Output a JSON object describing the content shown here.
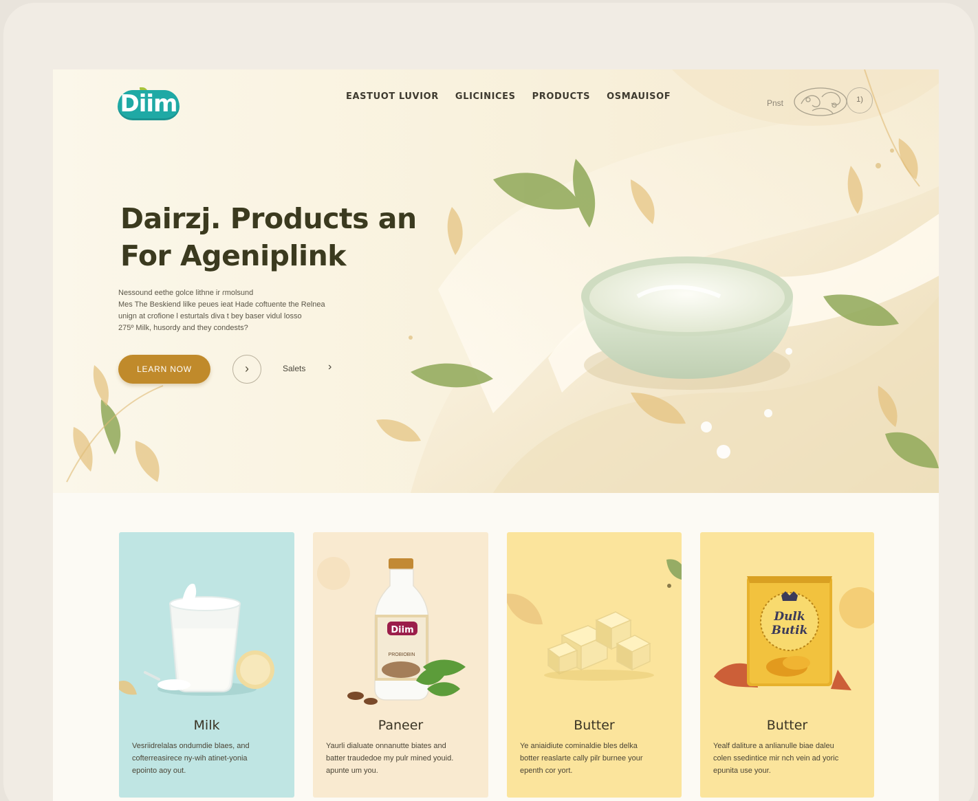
{
  "brand": {
    "logo_text": "Diim"
  },
  "nav": {
    "items": [
      {
        "label": "EASTUOT LUVIOR"
      },
      {
        "label": "GLICINICES"
      },
      {
        "label": "PRODUCTS"
      },
      {
        "label": "OSMAUISOF"
      }
    ],
    "print_label": "Pnst",
    "circle_button_label": "1)"
  },
  "hero": {
    "headline_line1": "Dairzj. Products an",
    "headline_line2": "For Ageniplink",
    "desc_lines": [
      "Nessound eethe golce lithne ir ɾmolsund",
      "Mes The Beskiend lilke peues ieat Hade coftuente the Relnea",
      "unign at crofione l esturtals diva t bey baser vidul losso",
      "275º Milk, husordy and they condests?"
    ],
    "cta_label": "LEARN NOW",
    "arrow_glyph": "›",
    "secondary_link": "Salets",
    "secondary_chevron": "›"
  },
  "products": [
    {
      "title": "Milk",
      "desc_lines": [
        "Vesriidrelalas ondumdie blaes, and",
        "cofterreasirece ny-wih atinet-yonia",
        "epointo aoy out."
      ],
      "bg": "#bfe5e3"
    },
    {
      "title": "Paneer",
      "desc_lines": [
        "Yaurli dialuate onnanutte biates and",
        "batter traudedoe my pulr mined youid.",
        "apunte um you."
      ],
      "bg": "#f9ead0",
      "bottle_label": "Diim",
      "bottle_sublabel": "PROBIOBIN"
    },
    {
      "title": "Butter",
      "desc_lines": [
        "Ye aniaidiute cominaldie bles delka",
        "botter reaslarte cally pilr burnee your",
        "epenth cor yort."
      ],
      "bg": "#fbe49c"
    },
    {
      "title": "Butter",
      "desc_lines": [
        "Yealf daliture a anlianulle biae daleu",
        "colen ssedintice mir nch vein ad yoric",
        "epunita use your."
      ],
      "bg": "#fbe49c",
      "package_label_1": "Dulk",
      "package_label_2": "Butik"
    }
  ],
  "colors": {
    "accent": "#c08a2b",
    "brand": "#1fa9a5",
    "headline": "#3b3a1f",
    "milk_card": "#bfe5e3",
    "paneer_card": "#f9ead0",
    "butter_card": "#fbe49c"
  }
}
